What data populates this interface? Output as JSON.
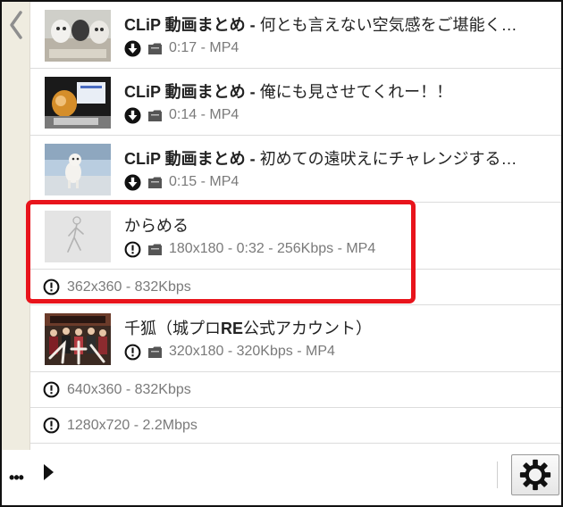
{
  "videos_top": [
    {
      "title_bold": "CLiP 動画まとめ - ",
      "title_rest": "何とも言えない空気感をご堪能く…",
      "status_icon": "download-icon",
      "meta": "0:17 - MP4"
    },
    {
      "title_bold": "CLiP 動画まとめ - ",
      "title_rest": "俺にも見させてくれー！！",
      "status_icon": "download-icon",
      "meta": "0:14 - MP4"
    },
    {
      "title_bold": "CLiP 動画まとめ - ",
      "title_rest": "初めての遠吠えにチャレンジする…",
      "status_icon": "download-icon",
      "meta": "0:15 - MP4"
    }
  ],
  "karameru": {
    "title": "からめる",
    "status_icon": "alert-icon",
    "meta": "180x180 - 0:32 - 256Kbps - MP4",
    "formats": [
      "362x360 - 832Kbps"
    ]
  },
  "senko": {
    "title_pre": "千狐（城プロ",
    "title_bold": "RE",
    "title_post": "公式アカウント）",
    "status_icon": "alert-icon",
    "meta": "320x180 - 320Kbps - MP4",
    "formats": [
      "640x360 - 832Kbps",
      "1280x720 - 2.2Mbps"
    ]
  },
  "toolbar": {
    "more_label": "•••",
    "more_icon": "ellipsis-icon",
    "play_icon": "play-icon",
    "settings_icon": "gear-icon"
  },
  "colors": {
    "highlight": "#e8141c",
    "sidebar": "#efece0",
    "meta_text": "#7a7a7a"
  }
}
